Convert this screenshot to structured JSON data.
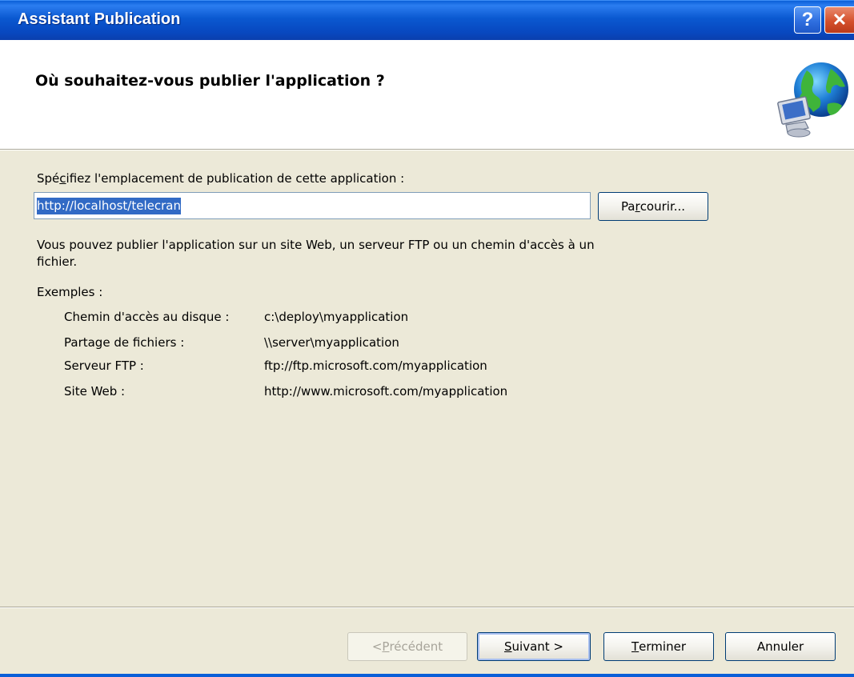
{
  "window": {
    "title": "Assistant Publication"
  },
  "header": {
    "title": "Où souhaitez-vous publier l'application ?",
    "icon": "network-globe-icon"
  },
  "form": {
    "label_pre": "Spé",
    "label_accel": "c",
    "label_post": "ifiez l'emplacement de publication de cette application :",
    "location_value": "http://localhost/telecran",
    "browse_pre": "Pa",
    "browse_accel": "r",
    "browse_post": "courir...",
    "help_line1": "Vous pouvez publier l'application sur un site Web, un serveur FTP ou un chemin d'accès à un",
    "help_line2": "fichier.",
    "examples_title": "Exemples :"
  },
  "examples": [
    {
      "label": "Chemin d'accès au disque :",
      "value": "c:\\deploy\\myapplication"
    },
    {
      "label": "Partage de fichiers :",
      "value": "\\\\server\\myapplication"
    },
    {
      "label": "Serveur FTP :",
      "value": "ftp://ftp.microsoft.com/myapplication"
    },
    {
      "label": "Site Web :",
      "value": "http://www.microsoft.com/myapplication"
    }
  ],
  "footer": {
    "prev_pre": "< ",
    "prev_accel": "P",
    "prev_post": "récédent",
    "next_accel": "S",
    "next_post": "uivant >",
    "finish_accel": "T",
    "finish_post": "erminer",
    "cancel": "Annuler"
  },
  "colors": {
    "titlebar": "#0a58d0",
    "dialog_bg": "#ece9d8",
    "selection": "#316ac5"
  }
}
